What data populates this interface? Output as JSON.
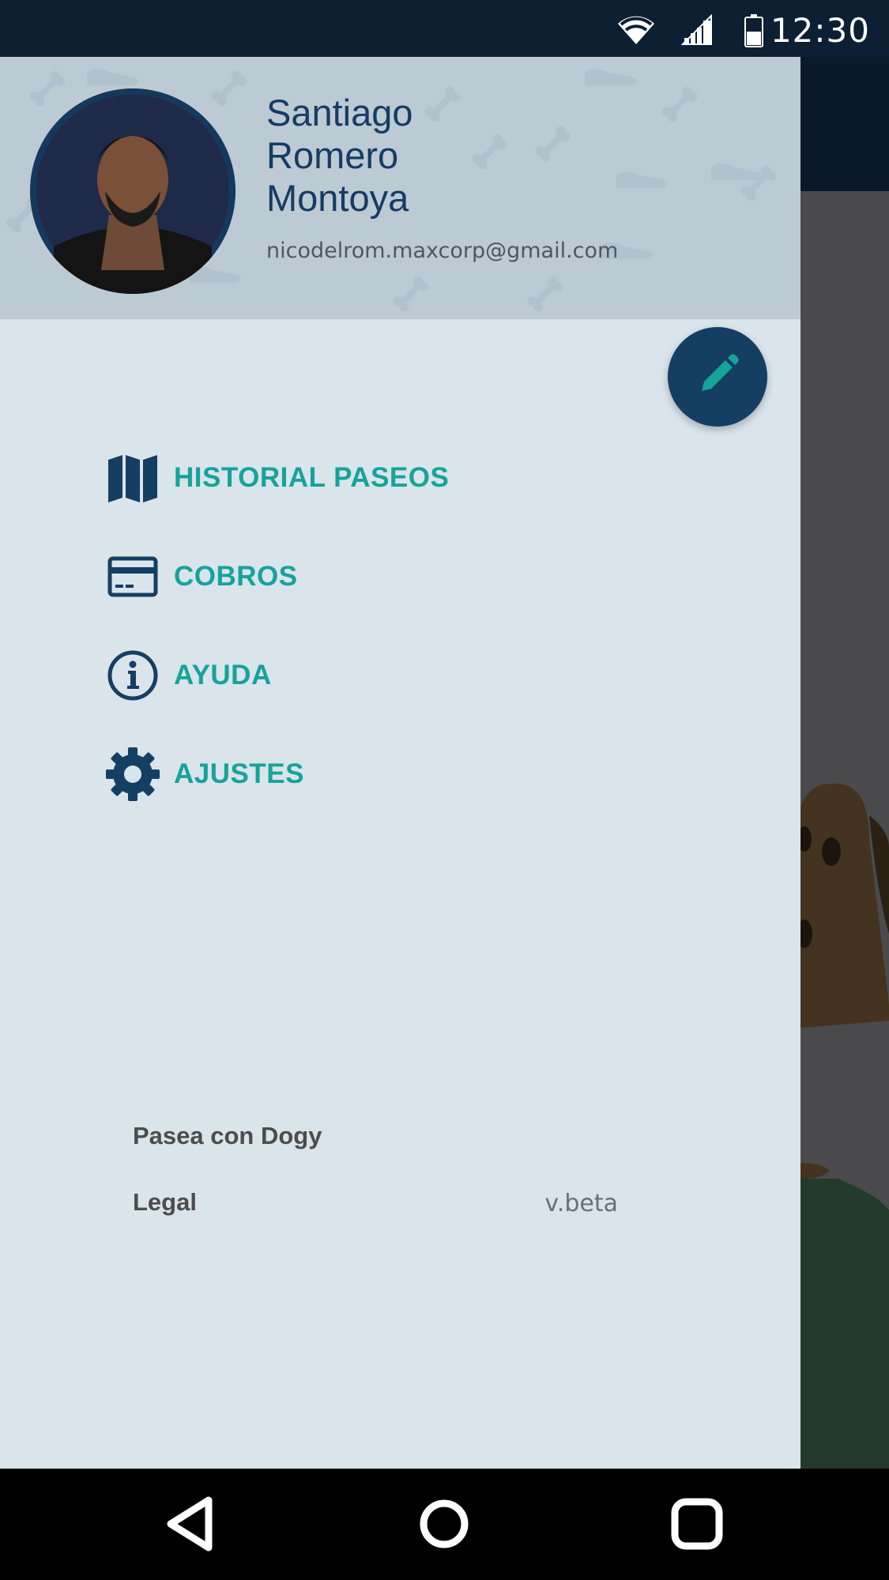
{
  "status_bar": {
    "time": "12:30",
    "icons": [
      "wifi-icon",
      "cell-signal-icon",
      "battery-icon"
    ]
  },
  "drawer": {
    "header": {
      "name_line1": "Santiago",
      "name_line2": "Romero",
      "name_line3": "Montoya",
      "email": "nicodelrom.maxcorp@gmail.com",
      "avatar_icon": "avatar",
      "edit_icon": "pencil-icon"
    },
    "menu": [
      {
        "label": "HISTORIAL PASEOS",
        "icon": "map-icon"
      },
      {
        "label": "COBROS",
        "icon": "credit-card-icon"
      },
      {
        "label": "AYUDA",
        "icon": "info-icon"
      },
      {
        "label": "AJUSTES",
        "icon": "gear-icon"
      }
    ],
    "footer": {
      "link1": "Pasea con Dogy",
      "link2": "Legal",
      "version": "v.beta"
    }
  },
  "nav_bar": {
    "icons": [
      "back-icon",
      "home-icon",
      "recents-icon"
    ]
  },
  "colors": {
    "primary": "#153e63",
    "accent": "#16a39a",
    "drawer_bg": "#dae4eb",
    "header_bg": "#bccad4",
    "status_bar": "#0c1f33"
  }
}
